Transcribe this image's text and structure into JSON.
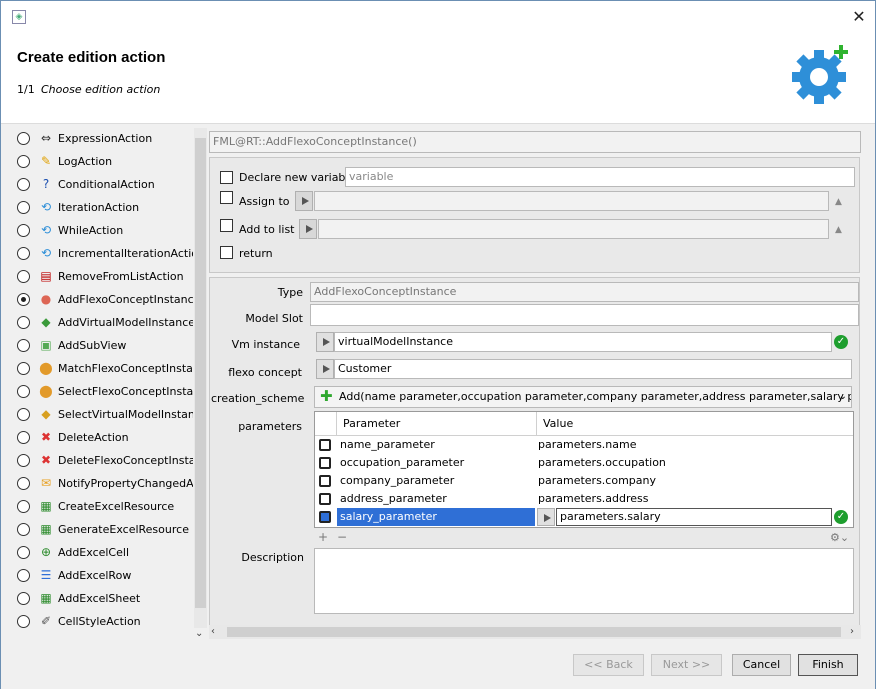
{
  "window": {
    "title_icon": "app-icon",
    "close_label": "✕"
  },
  "header": {
    "title": "Create edition action",
    "step": "1/1",
    "step_label": "Choose edition action"
  },
  "actions": [
    {
      "label": "ExpressionAction",
      "icon": "expression-icon",
      "selected": false
    },
    {
      "label": "LogAction",
      "icon": "pencil-icon",
      "selected": false
    },
    {
      "label": "ConditionalAction",
      "icon": "question-icon",
      "selected": false
    },
    {
      "label": "IterationAction",
      "icon": "loop-icon",
      "selected": false
    },
    {
      "label": "WhileAction",
      "icon": "loop-icon",
      "selected": false
    },
    {
      "label": "IncrementalIterationAction",
      "icon": "loop-icon",
      "selected": false
    },
    {
      "label": "RemoveFromListAction",
      "icon": "list-remove-icon",
      "selected": false
    },
    {
      "label": "AddFlexoConceptInstance",
      "icon": "concept-add-icon",
      "selected": true
    },
    {
      "label": "AddVirtualModelInstance",
      "icon": "virtual-model-icon",
      "selected": false
    },
    {
      "label": "AddSubView",
      "icon": "subview-icon",
      "selected": false
    },
    {
      "label": "MatchFlexoConceptInstance",
      "icon": "concept-match-icon",
      "selected": false
    },
    {
      "label": "SelectFlexoConceptInstance",
      "icon": "concept-select-icon",
      "selected": false
    },
    {
      "label": "SelectVirtualModelInstance",
      "icon": "vm-select-icon",
      "selected": false
    },
    {
      "label": "DeleteAction",
      "icon": "delete-icon",
      "selected": false
    },
    {
      "label": "DeleteFlexoConceptInstance",
      "icon": "concept-delete-icon",
      "selected": false
    },
    {
      "label": "NotifyPropertyChangedAction",
      "icon": "notify-icon",
      "selected": false
    },
    {
      "label": "CreateExcelResource",
      "icon": "excel-icon",
      "selected": false
    },
    {
      "label": "GenerateExcelResource",
      "icon": "excel-icon",
      "selected": false
    },
    {
      "label": "AddExcelCell",
      "icon": "excel-cell-icon",
      "selected": false
    },
    {
      "label": "AddExcelRow",
      "icon": "excel-row-icon",
      "selected": false
    },
    {
      "label": "AddExcelSheet",
      "icon": "excel-icon",
      "selected": false
    },
    {
      "label": "CellStyleAction",
      "icon": "brush-icon",
      "selected": false
    }
  ],
  "expression": "FML@RT::AddFlexoConceptInstance()",
  "options": {
    "declare_label": "Declare new variable",
    "declare_placeholder": "variable",
    "assign_label": "Assign to",
    "addlist_label": "Add to list",
    "return_label": "return"
  },
  "form": {
    "type_label": "Type",
    "type_value": "AddFlexoConceptInstance",
    "modelslot_label": "Model Slot",
    "modelslot_value": "",
    "vm_label": "Vm instance",
    "vm_value": "virtualModelInstance",
    "concept_label": "flexo concept",
    "concept_value": "Customer",
    "scheme_label": "creation_scheme",
    "scheme_value": "Add(name parameter,occupation parameter,company parameter,address parameter,salary parameter)",
    "params_label": "parameters",
    "description_label": "Description",
    "description_value": ""
  },
  "params_table": {
    "headers": [
      "Parameter",
      "Value"
    ],
    "rows": [
      {
        "name": "name_parameter",
        "value": "parameters.name"
      },
      {
        "name": "occupation_parameter",
        "value": "parameters.occupation"
      },
      {
        "name": "company_parameter",
        "value": "parameters.company"
      },
      {
        "name": "address_parameter",
        "value": "parameters.address"
      },
      {
        "name": "salary_parameter",
        "value": "parameters.salary"
      }
    ],
    "add_label": "+",
    "remove_label": "−"
  },
  "footer": {
    "back": "<< Back",
    "next": "Next >>",
    "cancel": "Cancel",
    "finish": "Finish"
  },
  "colors": {
    "selection": "#2f6fd6",
    "ok": "#1e9e2e",
    "accent": "#2e8fd8"
  }
}
